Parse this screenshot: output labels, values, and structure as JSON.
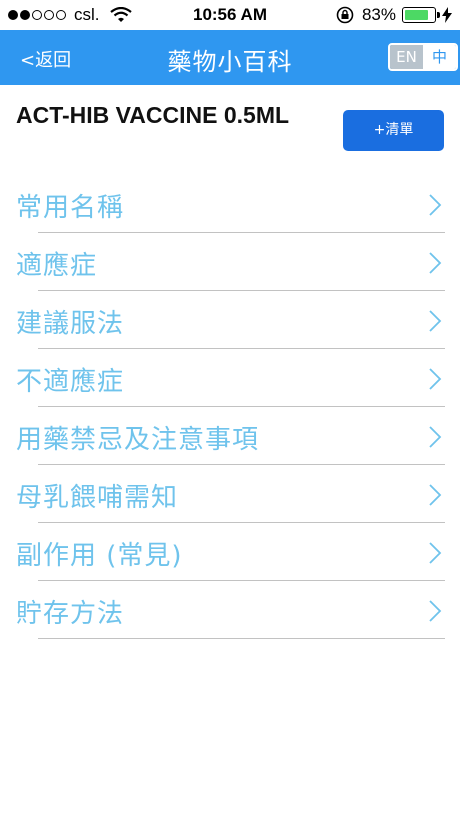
{
  "status_bar": {
    "carrier": "csl.",
    "time": "10:56 AM",
    "battery": "83%",
    "battery_level": 0.83,
    "signal_bars_filled": 2,
    "signal_bars_total": 5
  },
  "nav": {
    "back_label": "<返回",
    "title": "藥物小百科",
    "lang_en": "EN",
    "lang_zh": "中",
    "active_lang": "中",
    "accent_color": "#2f97f0"
  },
  "drug": {
    "name": "ACT-HIB VACCINE 0.5ML",
    "add_button_label": "+清單"
  },
  "sections": [
    {
      "label": "常用名稱"
    },
    {
      "label": "適應症"
    },
    {
      "label": "建議服法"
    },
    {
      "label": "不適應症"
    },
    {
      "label": "用藥禁忌及注意事項"
    },
    {
      "label": "母乳餵哺需知"
    },
    {
      "label": "副作用 (常見)"
    },
    {
      "label": "貯存方法"
    }
  ],
  "icons": {
    "chevron": "chevron-right-icon",
    "wifi": "wifi-icon",
    "rotation_lock": "rotation-lock-icon",
    "charging": "charging-bolt-icon"
  }
}
